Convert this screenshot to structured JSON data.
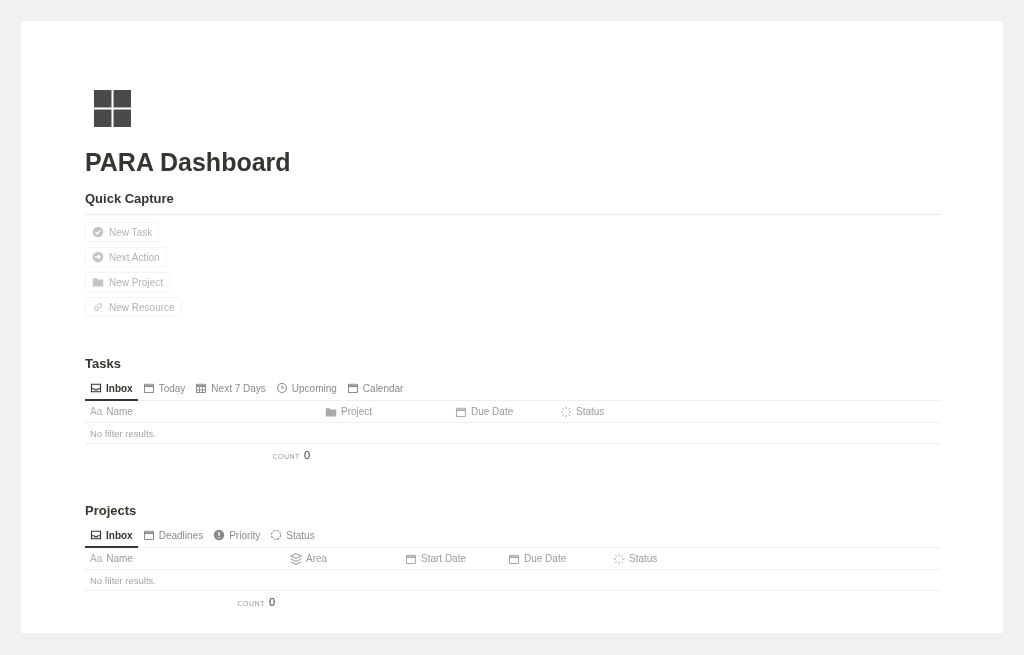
{
  "page": {
    "title": "PARA Dashboard"
  },
  "quick_capture": {
    "heading": "Quick Capture",
    "buttons": [
      {
        "label": "New Task"
      },
      {
        "label": "Next Action"
      },
      {
        "label": "New Project"
      },
      {
        "label": "New Resource"
      }
    ]
  },
  "databases": [
    {
      "heading": "Tasks",
      "tabs": [
        {
          "label": "Inbox",
          "selected": true
        },
        {
          "label": "Today",
          "selected": false
        },
        {
          "label": "Next 7 Days",
          "selected": false
        },
        {
          "label": "Upcoming",
          "selected": false
        },
        {
          "label": "Calendar",
          "selected": false
        }
      ],
      "columns": [
        {
          "icon_text": "Aa",
          "label": "Name"
        },
        {
          "label": "Project"
        },
        {
          "label": "Due Date"
        },
        {
          "label": "Status"
        }
      ],
      "empty_text": "No filter results.",
      "count_label": "COUNT",
      "count": "0"
    },
    {
      "heading": "Projects",
      "tabs": [
        {
          "label": "Inbox",
          "selected": true
        },
        {
          "label": "Deadlines",
          "selected": false
        },
        {
          "label": "Priority",
          "selected": false
        },
        {
          "label": "Status",
          "selected": false
        }
      ],
      "columns": [
        {
          "icon_text": "Aa",
          "label": "Name"
        },
        {
          "label": "Area"
        },
        {
          "label": "Start Date"
        },
        {
          "label": "Due Date"
        },
        {
          "label": "Status"
        }
      ],
      "empty_text": "No filter results.",
      "count_label": "COUNT",
      "count": "0"
    }
  ]
}
